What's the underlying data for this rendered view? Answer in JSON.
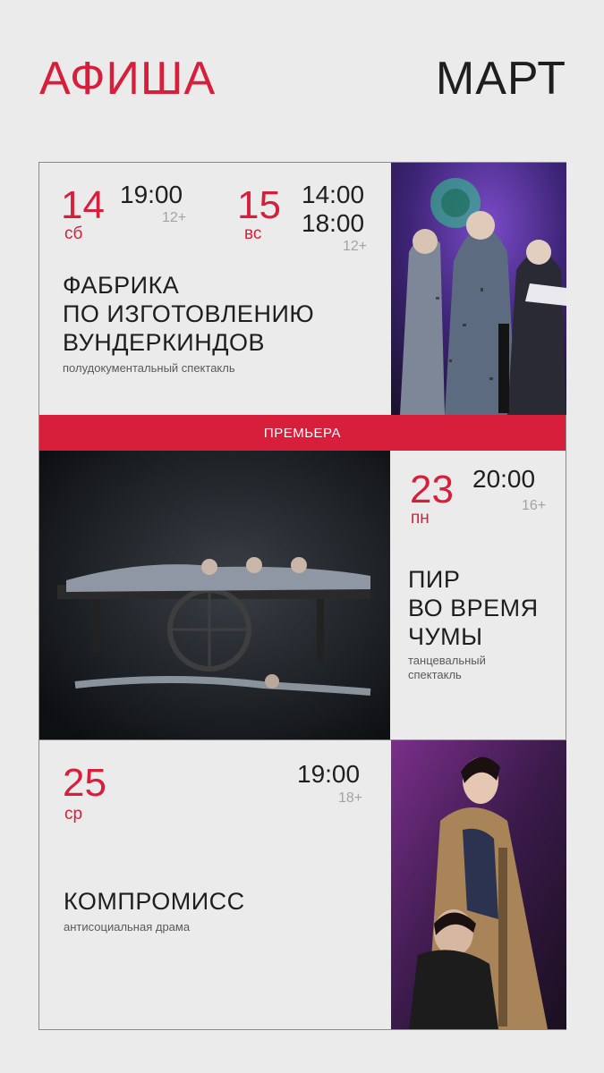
{
  "header": {
    "title": "АФИША",
    "month": "МАРТ"
  },
  "colors": {
    "accent": "#d71f3b",
    "background": "#ebebeb",
    "text": "#1e1e1e",
    "muted": "#a3a3a3"
  },
  "events": [
    {
      "dates": [
        {
          "day": "14",
          "weekday": "сб",
          "times": [
            "19:00"
          ],
          "age": "12+"
        },
        {
          "day": "15",
          "weekday": "вс",
          "times": [
            "14:00",
            "18:00"
          ],
          "age": "12+"
        }
      ],
      "title": "ФАБРИКА\nПО ИЗГОТОВЛЕНИЮ\nВУНДЕРКИНДОВ",
      "genre": "полудокументальный спектакль"
    },
    {
      "badge": "ПРЕМЬЕРА",
      "dates": [
        {
          "day": "23",
          "weekday": "пн",
          "times": [
            "20:00"
          ],
          "age": "16+"
        }
      ],
      "title": "ПИР\nВО ВРЕМЯ\nЧУМЫ",
      "genre": "танцевальный\nспектакль"
    },
    {
      "dates": [
        {
          "day": "25",
          "weekday": "ср",
          "times": [
            "19:00"
          ],
          "age": "18+"
        }
      ],
      "title": "КОМПРОМИСС",
      "genre": "антисоциальная драма"
    }
  ]
}
